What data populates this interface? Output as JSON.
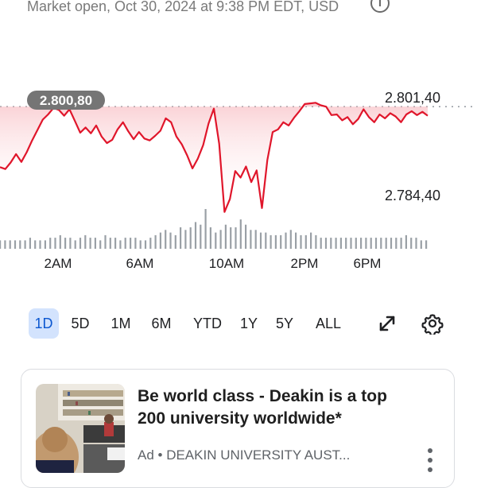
{
  "status": {
    "market_line": "Market open, Oct 30, 2024 at 9:38 PM EDT, USD",
    "info_icon": "info-icon"
  },
  "chart": {
    "reference_value_label": "2.800,80",
    "upper_label": "2.801,40",
    "lower_label": "2.784,40",
    "line_color": "#e0162b",
    "fill_color": "#fbd5d8",
    "bubble_color": "#757575"
  },
  "chart_data": {
    "type": "line",
    "x_ticks": [
      "2AM",
      "6AM",
      "10AM",
      "2PM",
      "6PM"
    ],
    "y_labels": [
      "2.801,40",
      "2.784,40"
    ],
    "reference_line": "2.800,80",
    "price_y_range": [
      2782,
      2804
    ],
    "series": [
      {
        "values": [
          2791.5,
          2791.2,
          2792.2,
          2793.5,
          2792.3,
          2793.8,
          2795.6,
          2797.2,
          2798.8,
          2799.6,
          2800.6,
          2800.3,
          2799.4,
          2800.4,
          2798.6,
          2796.8,
          2797.6,
          2796.7,
          2797.9,
          2796.2,
          2795.2,
          2795.7,
          2797.3,
          2798.4,
          2797.0,
          2795.8,
          2796.9,
          2795.9,
          2795.6,
          2796.3,
          2797.1,
          2799.0,
          2798.4,
          2796.2,
          2795.0,
          2793.3,
          2791.3,
          2792.8,
          2794.9,
          2798.2,
          2800.5,
          2795.1,
          2784.6,
          2786.6,
          2790.9,
          2789.9,
          2791.6,
          2789.2,
          2791.0,
          2785.2,
          2792.6,
          2796.9,
          2797.3,
          2798.4,
          2797.9,
          2799.1,
          2800.1,
          2801.2,
          2801.3,
          2801.4,
          2801.0,
          2800.8,
          2799.5,
          2799.6,
          2798.7,
          2799.2,
          2798.1,
          2798.9,
          2800.4,
          2799.2,
          2798.4,
          2799.6,
          2799.0,
          2799.8,
          2799.3,
          2798.4,
          2799.6,
          2800.1,
          2799.5,
          2800.0,
          2799.4
        ],
        "color": "#e0162b"
      }
    ],
    "volume": [
      2,
      2,
      2,
      2,
      2,
      2,
      3,
      2,
      2,
      2,
      3,
      3,
      4,
      3,
      3,
      2,
      3,
      4,
      3,
      3,
      2,
      4,
      3,
      3,
      2,
      3,
      3,
      3,
      2,
      2,
      3,
      4,
      5,
      6,
      5,
      4,
      7,
      6,
      7,
      9,
      8,
      14,
      7,
      5,
      6,
      8,
      7,
      7,
      10,
      8,
      6,
      6,
      5,
      5,
      4,
      4,
      4,
      5,
      6,
      5,
      4,
      4,
      5,
      4,
      3,
      3,
      3,
      3,
      3,
      3,
      3,
      3,
      3,
      3,
      3,
      3,
      3,
      3,
      3,
      3,
      3,
      4,
      3,
      3,
      2,
      2
    ]
  },
  "range_tabs": [
    {
      "label": "1D",
      "active": true
    },
    {
      "label": "5D"
    },
    {
      "label": "1M"
    },
    {
      "label": "6M"
    },
    {
      "label": "YTD"
    },
    {
      "label": "1Y"
    },
    {
      "label": "5Y"
    },
    {
      "label": "ALL"
    }
  ],
  "icons": {
    "expand": "expand-arrows-icon",
    "settings": "gear-icon"
  },
  "ad": {
    "title": "Be world class - Deakin is a top 200 university worldwide*",
    "meta": "Ad • DEAKIN UNIVERSITY AUST...",
    "menu_icon": "more-vertical-icon"
  }
}
